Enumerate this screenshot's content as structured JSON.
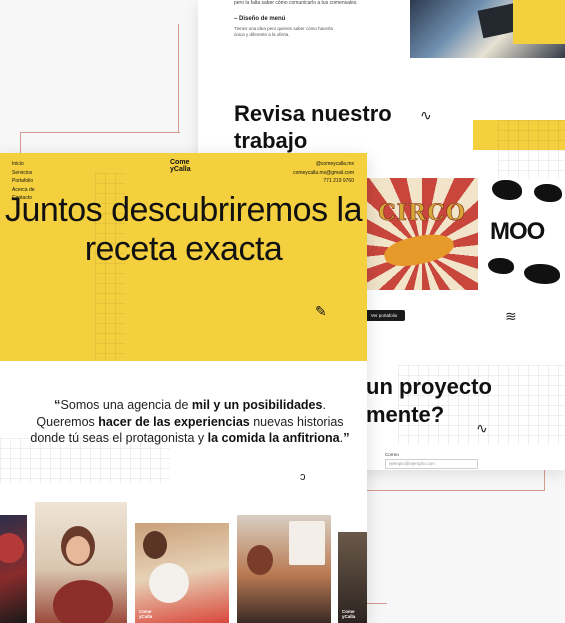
{
  "back": {
    "intro_text": "pero la falta saber cómo comunicarlo a tus comensales.",
    "menu_design_title": "– Diseño de menú",
    "menu_design_desc": "Tienes una idea pero quieres saber cómo hacerla única y diferente a la oferta.",
    "review_title": "Revisa nuestro trabajo",
    "posters": [
      {
        "label": "CIRCO"
      },
      {
        "label": "MOO"
      }
    ],
    "portfolio_button": "Ver portafolio",
    "project_title": "un proyecto\nmente?",
    "email_label": "Correo",
    "email_placeholder": "ejemplo@ejemplo.com"
  },
  "front": {
    "nav": [
      "Inicio",
      "Servicios",
      "Portafolio",
      "Acerca de",
      "Contacto"
    ],
    "logo": "Come\nyCalla",
    "contact": {
      "handle": "@comeycalla.mx",
      "email": "comeycalla.mx@gmail.com",
      "phone": "771 219 9760"
    },
    "hero_title": "Juntos descubriremos la receta exacta",
    "quote": {
      "part1": "Somos una agencia de ",
      "bold1": "mil y un posibilidades",
      "part2": ". Queremos ",
      "bold2": "hacer de las experiencias",
      "part3": " nuevas historias donde tú seas el protagonista y ",
      "bold3": "la comida la anfitriona",
      "part4": "."
    },
    "photo_caption": "Come\nyCalla"
  },
  "colors": {
    "brand_yellow": "#f4d03f",
    "ink": "#111111",
    "accent_line": "#d89a8e"
  }
}
